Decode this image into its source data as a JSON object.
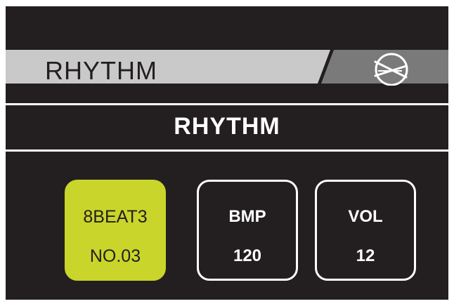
{
  "header": {
    "title": "RHYTHM",
    "icon": "drumsticks-icon",
    "bar_color": "#c9c9c9",
    "accent_color": "#7a7a7a"
  },
  "mode": {
    "title": "RHYTHM"
  },
  "cards": {
    "rhythm": {
      "name": "8BEAT3",
      "number": "NO.03",
      "selected": true
    },
    "bpm": {
      "label": "BMP",
      "value": "120"
    },
    "vol": {
      "label": "VOL",
      "value": "12"
    }
  },
  "colors": {
    "background": "#231e1f",
    "selected": "#c9d52a",
    "text": "#ffffff"
  }
}
